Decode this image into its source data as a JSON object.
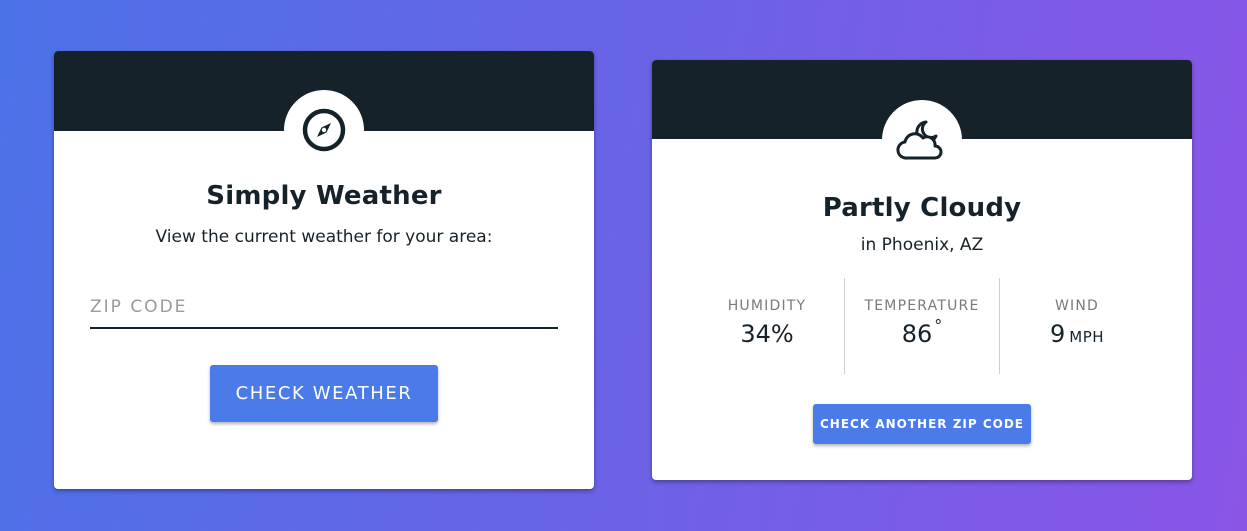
{
  "search_card": {
    "icon": "compass-icon",
    "title": "Simply Weather",
    "subtitle": "View the current weather for your area:",
    "zip_placeholder": "ZIP CODE",
    "zip_value": "",
    "button_label": "CHECK WEATHER"
  },
  "result_card": {
    "icon": "cloud-moon-icon",
    "title": "Partly Cloudy",
    "location": "in Phoenix, AZ",
    "stats": [
      {
        "label": "HUMIDITY",
        "value": "34%",
        "unit": ""
      },
      {
        "label": "TEMPERATURE",
        "value": "86",
        "unit": "°"
      },
      {
        "label": "WIND",
        "value": "9",
        "unit": "MPH"
      }
    ],
    "button_label": "CHECK ANOTHER ZIP CODE"
  },
  "colors": {
    "header": "#16222a",
    "button": "#4a7be8",
    "background_start": "#4c72e8",
    "background_end": "#8a55e6"
  }
}
